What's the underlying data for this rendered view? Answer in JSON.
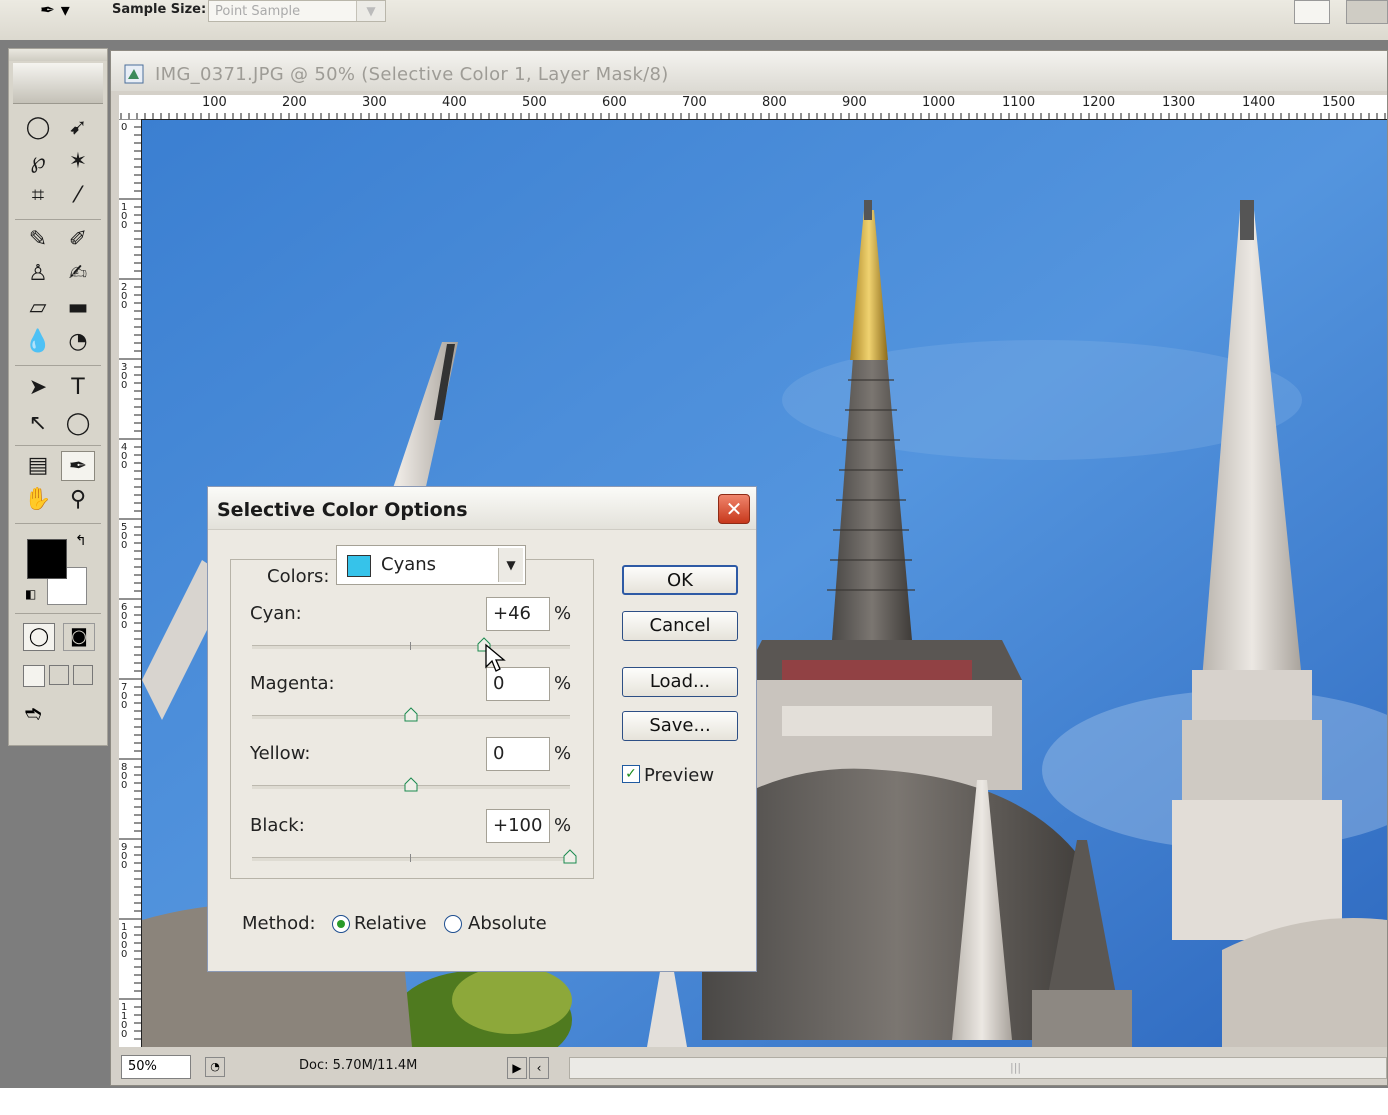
{
  "options_bar": {
    "sample_size_label": "Sample Size:",
    "sample_size_value": "Point Sample"
  },
  "document": {
    "title": "IMG_0371.JPG @ 50% (Selective Color 1, Layer Mask/8)",
    "hruler_labels": [
      "100",
      "200",
      "300",
      "400",
      "500",
      "600",
      "700",
      "800",
      "900",
      "1000",
      "1100",
      "1200",
      "1300",
      "1400",
      "1500"
    ],
    "vruler_labels": [
      "0",
      "100",
      "200",
      "300",
      "400",
      "500",
      "600",
      "700",
      "800",
      "900",
      "1000",
      "1100"
    ],
    "zoom": "50%",
    "doc_info": "Doc: 5.70M/11.4M"
  },
  "dialog": {
    "title": "Selective Color Options",
    "colors_label": "Colors:",
    "colors_value": "Cyans",
    "swatch_color": "#36c3ea",
    "sliders": [
      {
        "label": "Cyan:",
        "value": "+46",
        "level": 0.73
      },
      {
        "label": "Magenta:",
        "value": "0",
        "level": 0.5
      },
      {
        "label": "Yellow:",
        "value": "0",
        "level": 0.5
      },
      {
        "label": "Black:",
        "value": "+100",
        "level": 1.0
      }
    ],
    "percent": "%",
    "buttons": {
      "ok": "OK",
      "cancel": "Cancel",
      "load": "Load...",
      "save": "Save..."
    },
    "preview_label": "Preview",
    "preview_checked": true,
    "method_label": "Method:",
    "method_relative": "Relative",
    "method_absolute": "Absolute",
    "method_selected": "Relative"
  }
}
